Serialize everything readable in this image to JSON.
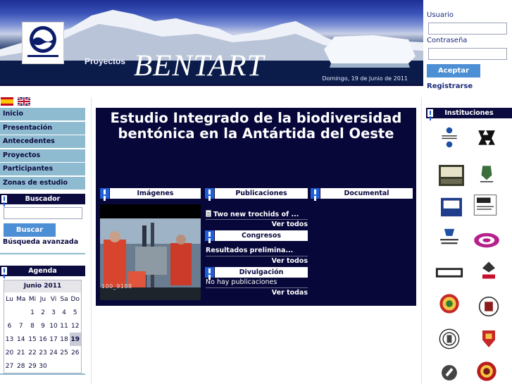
{
  "header": {
    "proyectos_label": "Proyectos",
    "site_title": "BENTART",
    "date": "Domingo, 19 de Junio de 2011"
  },
  "login": {
    "user_label": "Usuario",
    "password_label": "Contraseña",
    "accept_label": "Aceptar",
    "register_label": "Registrarse"
  },
  "nav": {
    "items": [
      "Inicio",
      "Presentación",
      "Antecedentes",
      "Proyectos",
      "Participantes",
      "Zonas de estudio"
    ]
  },
  "search": {
    "title": "Buscador",
    "button_label": "Buscar",
    "advanced_label": "Búsqueda avanzada"
  },
  "agenda": {
    "title": "Agenda",
    "month": "Junio 2011",
    "weekdays": [
      "Lu",
      "Ma",
      "Mi",
      "Ju",
      "Vi",
      "Sa",
      "Do"
    ],
    "weeks": [
      [
        "",
        "",
        "1",
        "2",
        "3",
        "4",
        "5"
      ],
      [
        "6",
        "7",
        "8",
        "9",
        "10",
        "11",
        "12"
      ],
      [
        "13",
        "14",
        "15",
        "16",
        "17",
        "18",
        "19"
      ],
      [
        "20",
        "21",
        "22",
        "23",
        "24",
        "25",
        "26"
      ],
      [
        "27",
        "28",
        "29",
        "30",
        "",
        "",
        ""
      ]
    ],
    "today": "19"
  },
  "main": {
    "title_line1": "Estudio Integrado de la biodiversidad",
    "title_line2": "bentónica en la Antártida del Oeste",
    "images_title": "Imágenes",
    "photo_caption": "100_9188",
    "publications": {
      "title": "Publicaciones",
      "item": "Two new trochids of ...",
      "see_all": "Ver todos"
    },
    "congresos": {
      "title": "Congresos",
      "item": "Resultados preliminа...",
      "see_all": "Ver todos"
    },
    "divulgacion": {
      "title": "Divulgación",
      "item": "No hay publicaciones",
      "see_all": "Ver todas"
    },
    "documental_title": "Documental"
  },
  "institutions": {
    "title": "Instituciones"
  },
  "colors": {
    "navy": "#0b0b40",
    "nav_blue": "#8fbbd1",
    "button_blue": "#4d8fd4",
    "bang_blue": "#1f5fd8"
  }
}
